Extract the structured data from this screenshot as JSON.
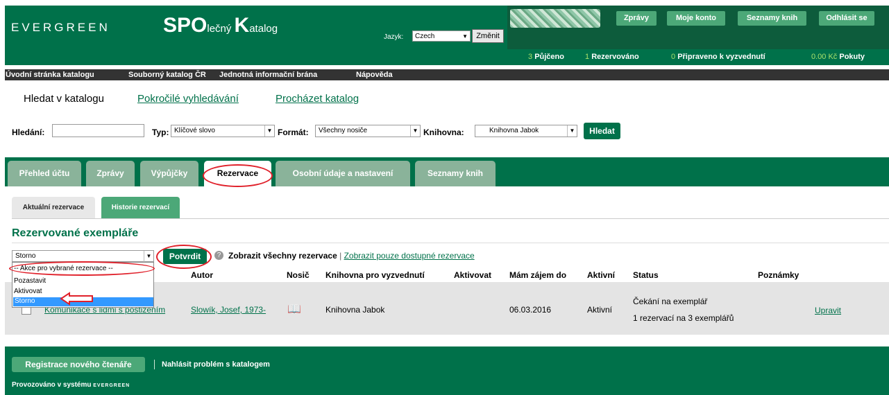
{
  "header": {
    "logo": "EVERGREEN",
    "title_big1": "SPO",
    "title_small1": "lečný ",
    "title_big2": "K",
    "title_small2": "atalog",
    "lang_label": "Jazyk:",
    "lang_value": "Czech",
    "lang_button": "Změnit",
    "buttons": [
      "Zprávy",
      "Moje konto",
      "Seznamy knih",
      "Odhlásit se"
    ],
    "stats": [
      {
        "num": "3",
        "label": "Půjčeno"
      },
      {
        "num": "1",
        "label": "Rezervováno"
      },
      {
        "num": "0",
        "label": "Připraveno k vyzvednutí"
      },
      {
        "num": "0.00 Kč",
        "label": "Pokuty"
      }
    ]
  },
  "nav": [
    "Úvodní stránka katalogu",
    "Souborný katalog ČR",
    "Jednotná informační brána",
    "Nápověda"
  ],
  "search": {
    "links": [
      "Hledat v katalogu",
      "Pokročilé vyhledávání",
      "Procházet katalog"
    ],
    "label_query": "Hledání:",
    "label_type": "Typ:",
    "type_value": "Klíčové slovo",
    "label_format": "Formát:",
    "format_value": "Všechny nosiče",
    "label_library": "Knihovna:",
    "library_value": "Knihovna Jabok",
    "button": "Hledat"
  },
  "tabs": [
    "Přehled účtu",
    "Zprávy",
    "Výpůjčky",
    "Rezervace",
    "Osobní údaje a nastavení",
    "Seznamy knih"
  ],
  "subtabs": [
    "Aktuální rezervace",
    "Historie rezervací"
  ],
  "heading": "Rezervované exempláře",
  "actions": {
    "selected": "Storno",
    "options": [
      "-- Akce pro vybrané rezervace --",
      "Pozastavit",
      "Aktivovat",
      "Storno"
    ],
    "confirm": "Potvrdit",
    "show_all": "Zobrazit všechny rezervace",
    "divider": "|",
    "show_available": "Zobrazit pouze dostupné rezervace"
  },
  "table": {
    "columns": [
      "Autor",
      "Nosič",
      "Knihovna pro vyzvednutí",
      "Aktivovat",
      "Mám zájem do",
      "Aktivní",
      "Status",
      "Poznámky"
    ],
    "row": {
      "title": "Komunikace s lidmi s postižením",
      "author": "Slowík, Josef, 1973-",
      "library": "Knihovna Jabok",
      "until": "06.03.2016",
      "active": "Aktivní",
      "status1": "Čekání na exemplář",
      "status2": "1 rezervací na 3 exemplářů",
      "edit": "Upravit"
    }
  },
  "footer": {
    "register": "Registrace nového čtenáře",
    "report": "Nahlásit problém s katalogem",
    "powered": "Provozováno v systému",
    "powered_logo": "EVERGREEN"
  },
  "colors": {
    "primary": "#00714a",
    "accent": "#4ca878",
    "highlight": "#e0202a"
  }
}
